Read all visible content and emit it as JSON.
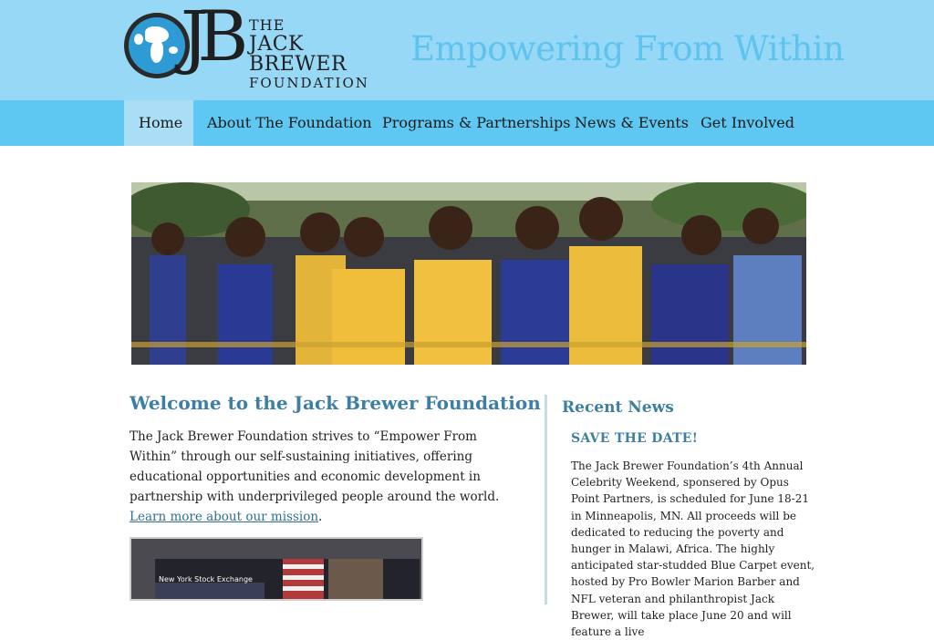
{
  "header": {
    "logo": {
      "line1": "THE",
      "line2": "JACK BREWER",
      "line3": "FOUNDATION",
      "monogram": "JB"
    },
    "tagline": "Empowering From Within"
  },
  "nav": {
    "items": [
      {
        "label": "Home",
        "active": true
      },
      {
        "label": "About The Foundation",
        "active": false
      },
      {
        "label": "Programs & Partnerships",
        "active": false
      },
      {
        "label": "News & Events",
        "active": false
      },
      {
        "label": "Get Involved",
        "active": false
      }
    ]
  },
  "welcome": {
    "title": "Welcome to the Jack Brewer Foundation",
    "body": "The Jack Brewer Foundation strives to “Empower From Within” through our self-sustaining initiatives, offering educational opportunities and economic development in partnership with underprivileged people around the world. ",
    "link": "Learn more about our mission",
    "after_link": "."
  },
  "video": {
    "caption": "New York Stock Exchange"
  },
  "news": {
    "title": "Recent News",
    "headline": "SAVE THE DATE!",
    "body": "The Jack Brewer Foundation’s 4th Annual Celebrity Weekend, sponsered by Opus Point Partners, is scheduled for June 18-21 in Minneapolis, MN. All proceeds will be dedicated to reducing the poverty and hunger in Malawi, Africa. The highly anticipated star-studded Blue Carpet event, hosted by Pro Bowler Marion Barber and NFL veteran and philanthropist Jack Brewer, will take place June 20 and will feature a live"
  },
  "colors": {
    "header_bg": "#96d8f6",
    "nav_bg": "#5ec8f2",
    "nav_active_bg": "#a9def6",
    "tagline": "#5ec3ef",
    "heading": "#3d7fa4"
  }
}
